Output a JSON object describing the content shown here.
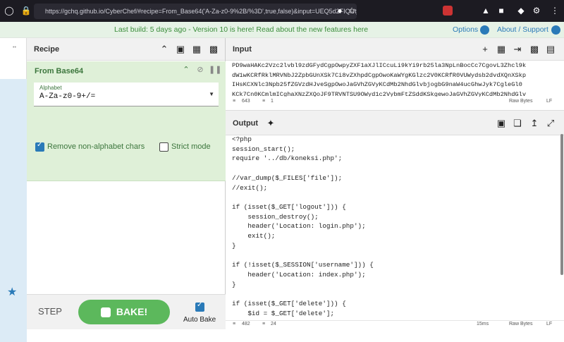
{
  "browser": {
    "url": "https://gchq.github.io/CyberChef/#recipe=From_Base64('A-Za-z0-9%2B/%3D',true,false)&input=UEQ5d2FIQUtjMlZ6c2..."
  },
  "notice": {
    "text": "Last build: 5 days ago - Version 10 is here! Read about the new features here",
    "options": "Options",
    "about": "About / Support"
  },
  "recipe": {
    "title": "Recipe",
    "operation": {
      "name": "From Base64",
      "alphabet_label": "Alphabet",
      "alphabet_value": "A-Za-z0-9+/=",
      "remove_label": "Remove non-alphabet chars",
      "remove_checked": true,
      "strict_label": "Strict mode",
      "strict_checked": false
    },
    "footer": {
      "step": "STEP",
      "bake": "BAKE!",
      "auto_bake": "Auto Bake",
      "auto_bake_checked": true
    }
  },
  "input": {
    "title": "Input",
    "text": "PD9waHAKc2Vzc2lvbl9zdGFydCgpOwpyZXF1aXJlICcuLi9kYi9rb25la3NpLnBocCc7CgovL3Zhcl9k\ndW1wKCRfRklMRVNbJ2ZpbGUnXSk7Ci8vZXhpdCgpOwoKaWYgKGlzc2V0KCRfR0VUWydsb2dvdXQnXSkp\nIHsKCXNlc3Npb25fZGVzdHJveSgpOwoJaGVhZGVyKCdMb2NhdGlvbjogbG9naW4ucGhwJyk7CgleGl0\nKCk7Cn0KCmlmICghaXNzZXQoJF9TRVNTSU9OWyd1c2VybmFtZSddKSkgewoJaGVhZGVyKCdMb2NhdGlv",
    "stats_chars": "643",
    "stats_lines": "1",
    "raw": "Raw Bytes",
    "eol": "LF"
  },
  "output": {
    "title": "Output",
    "text": "<?php\nsession_start();\nrequire '../db/koneksi.php';\n\n//var_dump($_FILES['file']);\n//exit();\n\nif (isset($_GET['logout'])) {\n    session_destroy();\n    header('Location: login.php');\n    exit();\n}\n\nif (!isset($_SESSION['username'])) {\n    header('Location: index.php');\n}\n\nif (isset($_GET['delete'])) {\n    $id = $_GET['delete'];",
    "stats_chars": "482",
    "stats_lines": "24",
    "time": "15ms",
    "raw": "Raw Bytes",
    "eol": "LF"
  }
}
